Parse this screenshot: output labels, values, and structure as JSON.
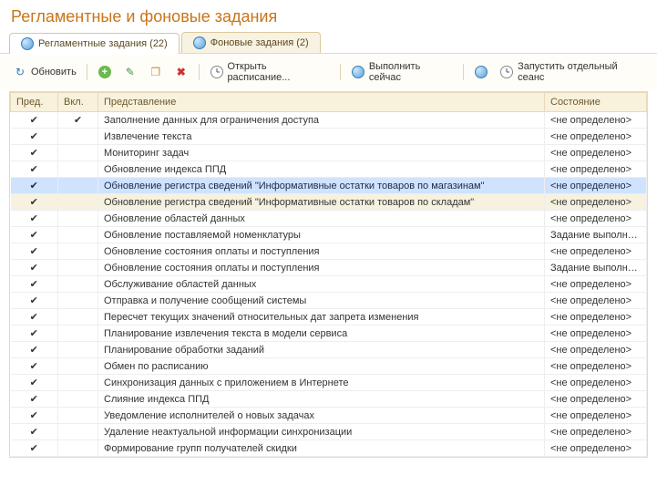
{
  "title": "Регламентные и фоновые задания",
  "tabs": [
    {
      "id": "regulated",
      "label": "Регламентные задания (22)",
      "active": true
    },
    {
      "id": "background",
      "label": "Фоновые задания (2)",
      "active": false
    }
  ],
  "toolbar": {
    "refresh": "Обновить",
    "open_schedule": "Открыть расписание...",
    "run_now": "Выполнить сейчас",
    "run_separate": "Запустить отдельный сеанс"
  },
  "columns": {
    "pred": "Пред.",
    "vkl": "Вкл.",
    "representation": "Представление",
    "state": "Состояние"
  },
  "state_undefined": "<не определено>",
  "state_done": "Задание выполнено",
  "check_glyph": "✔",
  "rows": [
    {
      "pred": true,
      "vkl": true,
      "rep": "Заполнение данных для ограничения доступа",
      "state": "<не определено>"
    },
    {
      "pred": true,
      "vkl": false,
      "rep": "Извлечение текста",
      "state": "<не определено>"
    },
    {
      "pred": true,
      "vkl": false,
      "rep": "Мониторинг задач",
      "state": "<не определено>"
    },
    {
      "pred": true,
      "vkl": false,
      "rep": "Обновление индекса ППД",
      "state": "<не определено>"
    },
    {
      "pred": true,
      "vkl": false,
      "rep": "Обновление регистра сведений \"Информативные остатки товаров по магазинам\"",
      "state": "<не определено>",
      "selected": true
    },
    {
      "pred": true,
      "vkl": false,
      "rep": "Обновление регистра сведений \"Информативные остатки товаров по складам\"",
      "state": "<не определено>",
      "hover": true
    },
    {
      "pred": true,
      "vkl": false,
      "rep": "Обновление областей данных",
      "state": "<не определено>"
    },
    {
      "pred": true,
      "vkl": false,
      "rep": "Обновление поставляемой номенклатуры",
      "state": "Задание выполнено"
    },
    {
      "pred": true,
      "vkl": false,
      "rep": "Обновление состояния оплаты и поступления",
      "state": "<не определено>"
    },
    {
      "pred": true,
      "vkl": false,
      "rep": "Обновление состояния оплаты и поступления",
      "state": "Задание выполнено"
    },
    {
      "pred": true,
      "vkl": false,
      "rep": "Обслуживание областей данных",
      "state": "<не определено>"
    },
    {
      "pred": true,
      "vkl": false,
      "rep": "Отправка и получение сообщений системы",
      "state": "<не определено>"
    },
    {
      "pred": true,
      "vkl": false,
      "rep": "Пересчет текущих значений относительных дат запрета изменения",
      "state": "<не определено>"
    },
    {
      "pred": true,
      "vkl": false,
      "rep": "Планирование извлечения текста в модели сервиса",
      "state": "<не определено>"
    },
    {
      "pred": true,
      "vkl": false,
      "rep": "Планирование обработки заданий",
      "state": "<не определено>"
    },
    {
      "pred": true,
      "vkl": false,
      "rep": "Обмен по расписанию",
      "state": "<не определено>"
    },
    {
      "pred": true,
      "vkl": false,
      "rep": "Синхронизация данных с приложением в Интернете",
      "state": "<не определено>"
    },
    {
      "pred": true,
      "vkl": false,
      "rep": "Слияние индекса ППД",
      "state": "<не определено>"
    },
    {
      "pred": true,
      "vkl": false,
      "rep": "Уведомление исполнителей о новых задачах",
      "state": "<не определено>"
    },
    {
      "pred": true,
      "vkl": false,
      "rep": "Удаление неактуальной информации синхронизации",
      "state": "<не определено>"
    },
    {
      "pred": true,
      "vkl": false,
      "rep": "Формирование групп получателей скидки",
      "state": "<не определено>"
    }
  ]
}
